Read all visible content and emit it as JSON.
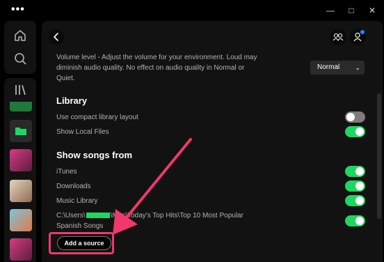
{
  "window": {
    "menu_icon": "more-horizontal-icon",
    "controls": [
      "—",
      "□",
      "✕"
    ]
  },
  "nav": {
    "icons": [
      "home-icon",
      "search-icon",
      "library-icon"
    ]
  },
  "library": {
    "items": [
      {
        "icon": "playlist-cover",
        "color": "#1f7a3a"
      },
      {
        "icon": "folder-icon",
        "color": "#1ed760"
      },
      {
        "icon": "album-cover",
        "color": "#c43a7a"
      },
      {
        "icon": "album-cover",
        "color": "#d9c3a8"
      },
      {
        "icon": "album-cover",
        "color": "#6ab0c8"
      },
      {
        "icon": "album-cover",
        "color": "#c43a7a"
      }
    ]
  },
  "header": {
    "back_icon": "chevron-left-icon",
    "friends_icon": "friends-activity-icon",
    "profile_icon": "user-icon"
  },
  "settings": {
    "volume_desc_line1": "Volume level - Adjust the volume for your environment. Loud may",
    "volume_desc_line2": "diminish audio quality. No effect on audio quality in Normal or",
    "volume_desc_line3": "Quiet.",
    "volume_value": "Normal",
    "library_title": "Library",
    "compact_label": "Use compact library layout",
    "compact_on": false,
    "local_files_label": "Show Local Files",
    "local_files_on": true,
    "show_songs_title": "Show songs from",
    "sources": [
      {
        "label": "iTunes",
        "on": true
      },
      {
        "label": "Downloads",
        "on": true
      },
      {
        "label": "Music Library",
        "on": true
      }
    ],
    "custom_path_prefix": "C:\\Users\\",
    "custom_path_suffix": "\\Mus\\Today's Top Hits\\Top 10 Most Popular",
    "custom_path_line2": "Spanish Songs",
    "custom_path_on": true,
    "add_source_label": "Add a source"
  },
  "colors": {
    "accent": "#1ed760",
    "annotation": "#f0386b"
  }
}
